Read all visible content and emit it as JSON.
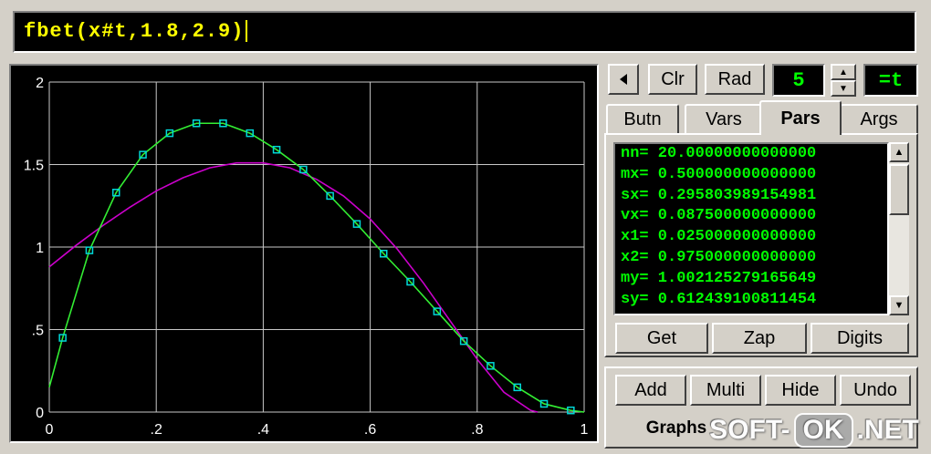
{
  "expression": {
    "text": "fbet(x#t,1.8,2.9)"
  },
  "toolbar": {
    "back_icon": "left-triangle",
    "clr_label": "Clr",
    "rad_label": "Rad",
    "digits_display": "5",
    "spin_up_icon": "up-arrow",
    "spin_down_icon": "down-arrow",
    "var_display": "=t"
  },
  "tabs": [
    {
      "label": "Butn",
      "active": false
    },
    {
      "label": "Vars",
      "active": false
    },
    {
      "label": "Pars",
      "active": true
    },
    {
      "label": "Args",
      "active": false
    }
  ],
  "pars": [
    "nn= 20.00000000000000",
    "mx= 0.500000000000000",
    "sx= 0.295803989154981",
    "vx= 0.087500000000000",
    "x1= 0.025000000000000",
    "x2= 0.975000000000000",
    "my= 1.002125279165649",
    "sy= 0.612439100811454"
  ],
  "pars_buttons": {
    "get": "Get",
    "zap": "Zap",
    "digits": "Digits"
  },
  "graph_buttons": {
    "add": "Add",
    "multi": "Multi",
    "hide": "Hide",
    "undo": "Undo"
  },
  "graphs_tab": {
    "label": "Graphs"
  },
  "watermark": {
    "left": "SOFT-",
    "mid": "OK",
    "right": ".NET"
  },
  "colors": {
    "background": "#000000",
    "grid": "#c8c8c8",
    "series_green": "#33ee33",
    "series_magenta": "#cc00cc",
    "marker": "#00d8d8",
    "lcd_text": "#00ff00",
    "expr_text": "#ffff00"
  },
  "chart_data": {
    "type": "line",
    "xlim": [
      0,
      1
    ],
    "ylim": [
      0,
      2
    ],
    "xticks": [
      "0",
      ".2",
      ".4",
      ".6",
      ".8",
      "1"
    ],
    "yticks": [
      "0",
      ".5",
      "1",
      "1.5",
      "2"
    ],
    "grid": true,
    "series": [
      {
        "style": "green-line-with-square-markers",
        "x": [
          0,
          0.025,
          0.075,
          0.125,
          0.175,
          0.225,
          0.275,
          0.325,
          0.375,
          0.425,
          0.475,
          0.525,
          0.575,
          0.625,
          0.675,
          0.725,
          0.775,
          0.825,
          0.875,
          0.925,
          0.975,
          1.0
        ],
        "y": [
          0.15,
          0.45,
          0.98,
          1.33,
          1.56,
          1.69,
          1.75,
          1.75,
          1.69,
          1.59,
          1.47,
          1.31,
          1.14,
          0.96,
          0.79,
          0.61,
          0.43,
          0.28,
          0.15,
          0.05,
          0.01,
          0.0
        ],
        "markers_x": [
          0.025,
          0.075,
          0.125,
          0.175,
          0.225,
          0.275,
          0.325,
          0.375,
          0.425,
          0.475,
          0.525,
          0.575,
          0.625,
          0.675,
          0.725,
          0.775,
          0.825,
          0.875,
          0.925,
          0.975
        ]
      },
      {
        "style": "magenta-line",
        "x": [
          0,
          0.05,
          0.1,
          0.15,
          0.2,
          0.25,
          0.3,
          0.35,
          0.4,
          0.45,
          0.5,
          0.55,
          0.6,
          0.65,
          0.7,
          0.75,
          0.8,
          0.85,
          0.9,
          0.913
        ],
        "y": [
          0.88,
          1.01,
          1.13,
          1.24,
          1.34,
          1.42,
          1.48,
          1.51,
          1.51,
          1.48,
          1.41,
          1.31,
          1.17,
          0.99,
          0.78,
          0.55,
          0.32,
          0.12,
          0.01,
          0.0
        ]
      }
    ]
  }
}
